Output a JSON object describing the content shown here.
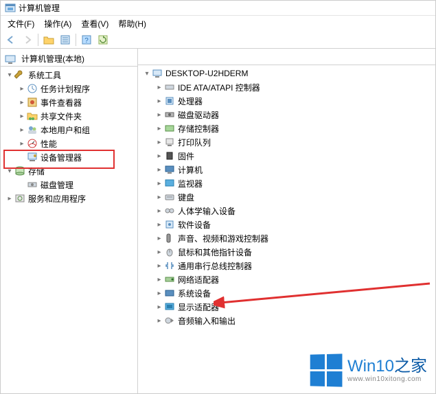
{
  "window": {
    "title": "计算机管理"
  },
  "menu": {
    "file": "文件(F)",
    "action": "操作(A)",
    "view": "查看(V)",
    "help": "帮助(H)"
  },
  "leftTree": {
    "root": "计算机管理(本地)",
    "systemTools": "系统工具",
    "children": {
      "taskScheduler": "任务计划程序",
      "eventViewer": "事件查看器",
      "sharedFolders": "共享文件夹",
      "localUsers": "本地用户和组",
      "performance": "性能",
      "deviceManager": "设备管理器"
    },
    "storage": "存储",
    "diskMgmt": "磁盘管理",
    "services": "服务和应用程序"
  },
  "rightTree": {
    "root": "DESKTOP-U2HDERM",
    "items": [
      "IDE ATA/ATAPI 控制器",
      "处理器",
      "磁盘驱动器",
      "存储控制器",
      "打印队列",
      "固件",
      "计算机",
      "监视器",
      "键盘",
      "人体学输入设备",
      "软件设备",
      "声音、视频和游戏控制器",
      "鼠标和其他指针设备",
      "通用串行总线控制器",
      "网络适配器",
      "系统设备",
      "显示适配器",
      "音频输入和输出"
    ]
  },
  "watermark": {
    "brandA": "Win10",
    "brandB": "之家",
    "url": "www.win10xitong.com"
  }
}
